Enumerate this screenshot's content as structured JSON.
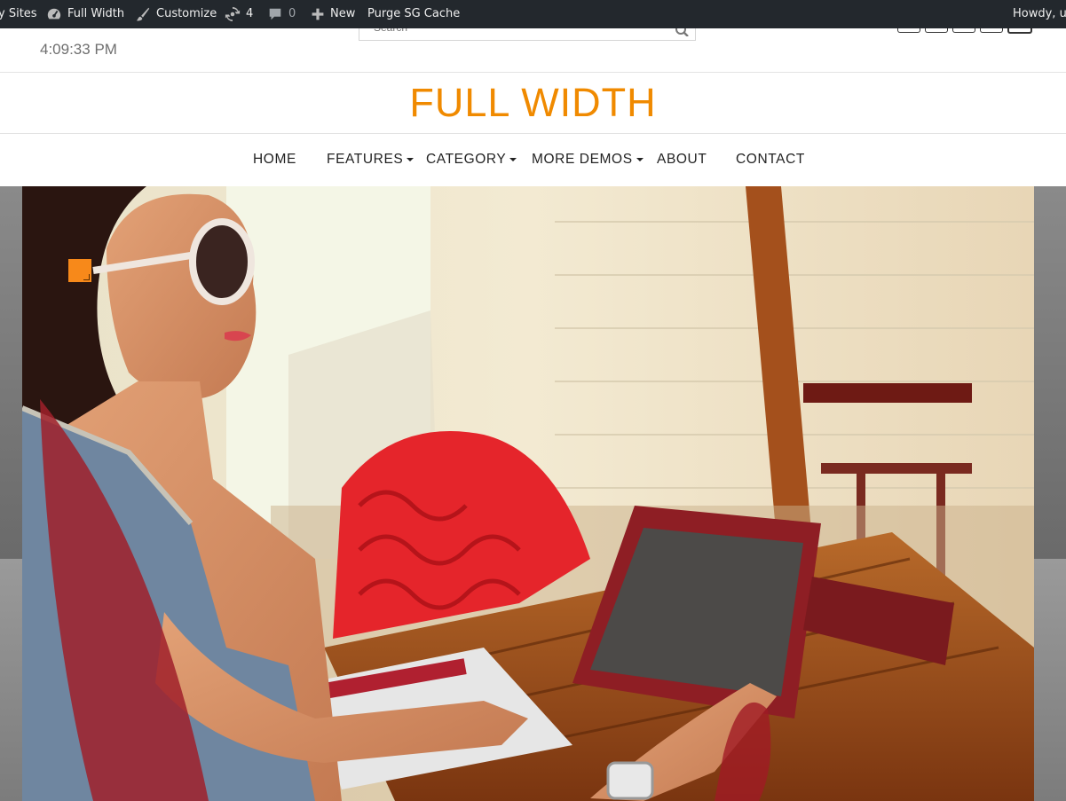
{
  "admin_bar": {
    "my_sites": "y Sites",
    "site_name": "Full Width",
    "customize": "Customize",
    "updates_count": "4",
    "comments_count": "0",
    "new_label": "New",
    "purge_label": "Purge SG Cache",
    "howdy": "Howdy, ut"
  },
  "topbar": {
    "time": "4:09:33 PM",
    "search_placeholder": "Search"
  },
  "site": {
    "title": "FULL WIDTH"
  },
  "nav": {
    "items": [
      {
        "label": "HOME",
        "dropdown": false
      },
      {
        "label": "FEATURES",
        "dropdown": true
      },
      {
        "label": "CATEGORY",
        "dropdown": true
      },
      {
        "label": "MORE DEMOS",
        "dropdown": true
      },
      {
        "label": "ABOUT",
        "dropdown": false
      },
      {
        "label": "CONTACT",
        "dropdown": false
      }
    ]
  },
  "hero": {
    "image": "woman-sunglasses-tablet-photo"
  },
  "colors": {
    "accent": "#f08a00",
    "admin_bar": "#23282d",
    "edit_badge": "#f7891a"
  }
}
